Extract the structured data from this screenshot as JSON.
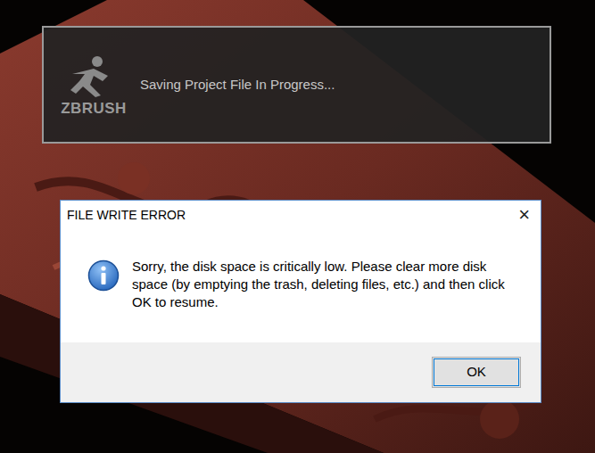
{
  "progress": {
    "logo": "ZBRUSH",
    "message": "Saving Project File In Progress..."
  },
  "dialog": {
    "title": "FILE WRITE ERROR",
    "close": "×",
    "message": "Sorry, the disk space is critically low. Please clear more disk space (by emptying the trash, deleting files, etc.) and then click OK to resume.",
    "buttons": [
      "OK"
    ]
  }
}
